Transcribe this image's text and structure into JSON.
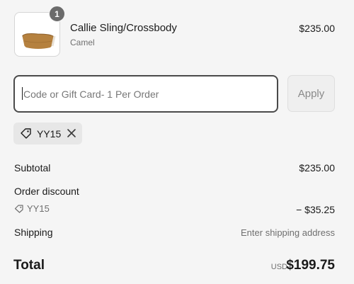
{
  "line_item": {
    "quantity": "1",
    "name": "Callie Sling/Crossbody",
    "variant": "Camel",
    "price": "$235.00"
  },
  "discount": {
    "placeholder": "Code or Gift Card- 1 Per Order",
    "value": "",
    "apply_label": "Apply",
    "applied_code": "YY15"
  },
  "summary": {
    "subtotal_label": "Subtotal",
    "subtotal_value": "$235.00",
    "order_discount_label": "Order discount",
    "discount_code": "YY15",
    "discount_value": "− $35.25",
    "shipping_label": "Shipping",
    "shipping_value": "Enter shipping address",
    "total_label": "Total",
    "currency": "USD",
    "total_value": "$199.75"
  },
  "colors": {
    "background": "#f5f5f5",
    "text": "#1a1a1a",
    "muted": "#707070",
    "bag": "#b5813f"
  }
}
